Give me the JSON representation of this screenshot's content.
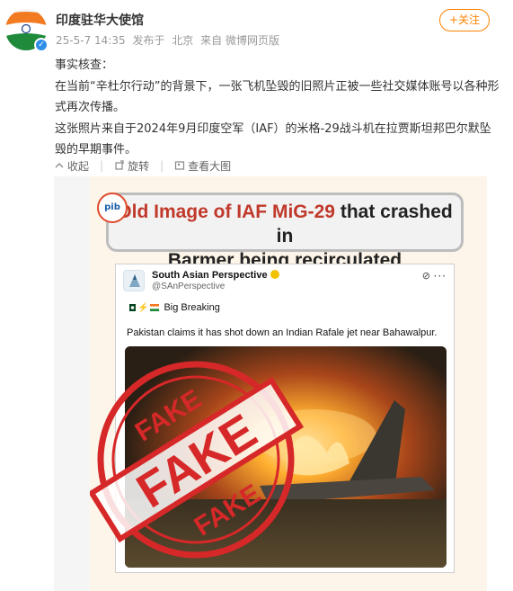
{
  "post": {
    "username": "印度驻华大使馆",
    "date": "25-5-7 14:35",
    "source_prefix": "发布于",
    "location": "北京",
    "via": "来自 微博网页版",
    "follow_label": "+关注",
    "paragraphs": [
      "事实核查：",
      "在当前“辛杜尔行动”的背景下，一张飞机坠毁的旧照片正被一些社交媒体账号以各种形式再次传播。",
      "这张照片来自于2024年9月印度空军（IAF）的米格-29战斗机在拉贾斯坦邦巴尔默坠毁的早期事件。"
    ],
    "actions": [
      {
        "icon": "collapse-icon",
        "label": "收起"
      },
      {
        "icon": "rotate-icon",
        "label": "旋转"
      },
      {
        "icon": "view-large-icon",
        "label": "查看大图"
      }
    ]
  },
  "infographic": {
    "logo_text": "pib",
    "headline_part1": "Old Image of IAF MiG-29",
    "headline_part2": "that crashed in",
    "headline_part3": "Barmer being recirculated",
    "tweet": {
      "name": "South Asian Perspective",
      "handle": "@SAnPerspective",
      "breaking": "Big Breaking",
      "text": "Pakistan claims it has shot down an Indian Rafale jet near Bahawalpur."
    },
    "stamp_words": [
      "FAKE",
      "FAKE",
      "FAKE"
    ]
  },
  "colors": {
    "accent": "#ff8200",
    "verified": "#2e8ee8",
    "stamp_red": "#d62828",
    "headline_red": "#c0392b"
  }
}
